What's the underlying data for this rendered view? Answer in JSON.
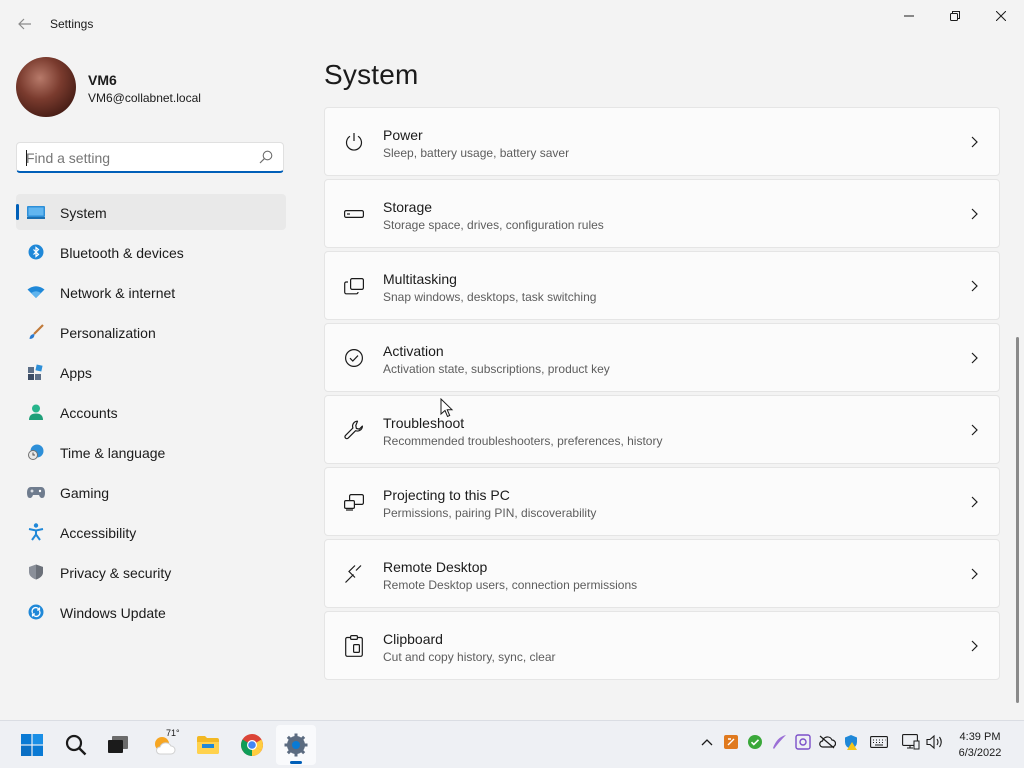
{
  "window": {
    "title": "Settings",
    "controls": [
      "minimize",
      "maximize",
      "close"
    ]
  },
  "profile": {
    "name": "VM6",
    "email": "VM6@collabnet.local"
  },
  "search": {
    "placeholder": "Find a setting",
    "value": ""
  },
  "sidebar": {
    "items": [
      {
        "label": "System",
        "icon": "monitor-icon",
        "selected": true
      },
      {
        "label": "Bluetooth & devices",
        "icon": "bluetooth-icon"
      },
      {
        "label": "Network & internet",
        "icon": "wifi-icon"
      },
      {
        "label": "Personalization",
        "icon": "brush-icon"
      },
      {
        "label": "Apps",
        "icon": "apps-icon"
      },
      {
        "label": "Accounts",
        "icon": "person-icon"
      },
      {
        "label": "Time & language",
        "icon": "clock-globe-icon"
      },
      {
        "label": "Gaming",
        "icon": "gamepad-icon"
      },
      {
        "label": "Accessibility",
        "icon": "accessibility-icon"
      },
      {
        "label": "Privacy & security",
        "icon": "shield-icon"
      },
      {
        "label": "Windows Update",
        "icon": "update-icon"
      }
    ]
  },
  "main": {
    "title": "System",
    "cards": [
      {
        "title": "Power",
        "subtitle": "Sleep, battery usage, battery saver",
        "icon": "power-icon"
      },
      {
        "title": "Storage",
        "subtitle": "Storage space, drives, configuration rules",
        "icon": "storage-icon"
      },
      {
        "title": "Multitasking",
        "subtitle": "Snap windows, desktops, task switching",
        "icon": "multitasking-icon"
      },
      {
        "title": "Activation",
        "subtitle": "Activation state, subscriptions, product key",
        "icon": "activation-check-icon"
      },
      {
        "title": "Troubleshoot",
        "subtitle": "Recommended troubleshooters, preferences, history",
        "icon": "wrench-icon"
      },
      {
        "title": "Projecting to this PC",
        "subtitle": "Permissions, pairing PIN, discoverability",
        "icon": "projecting-icon"
      },
      {
        "title": "Remote Desktop",
        "subtitle": "Remote Desktop users, connection permissions",
        "icon": "remote-desktop-icon"
      },
      {
        "title": "Clipboard",
        "subtitle": "Cut and copy history, sync, clear",
        "icon": "clipboard-icon"
      }
    ]
  },
  "taskbar": {
    "weather_temp": "71°",
    "clock_time": "4:39 PM",
    "clock_date": "6/3/2022"
  },
  "colors": {
    "accent": "#005fb8",
    "background": "#f3f3f3",
    "card": "#fbfbfb"
  }
}
